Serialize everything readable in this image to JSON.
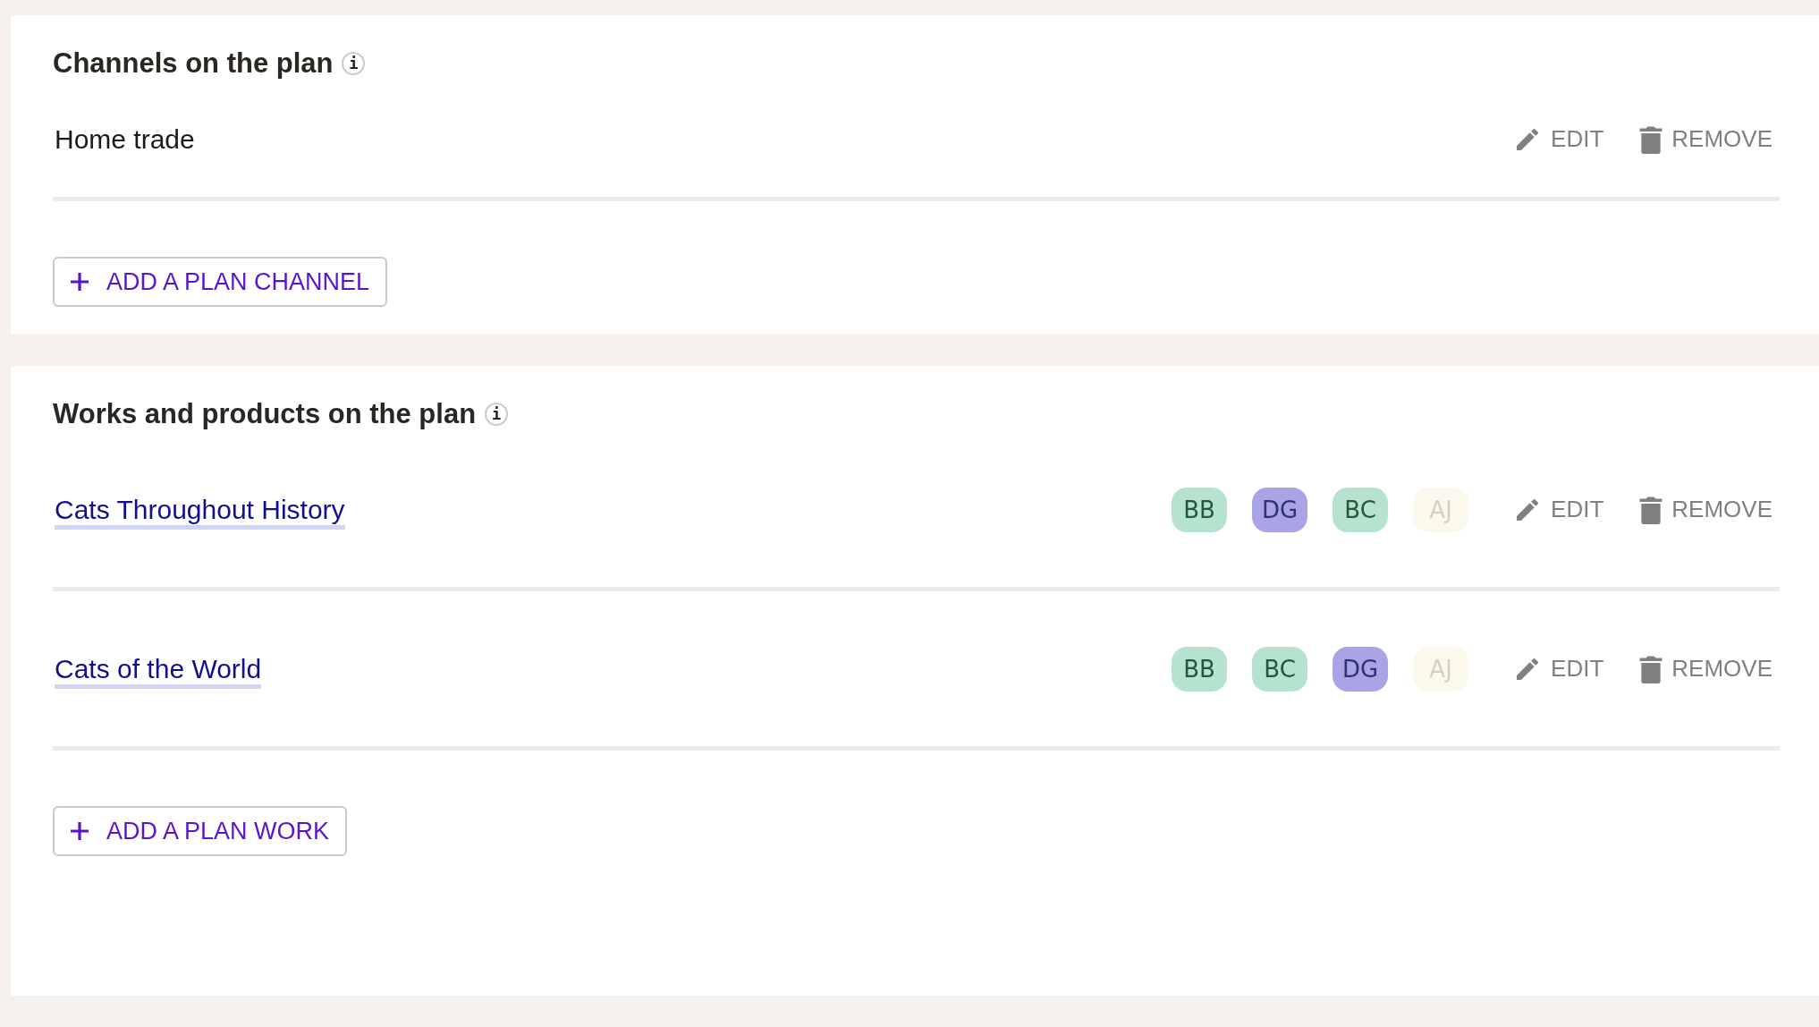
{
  "sections": [
    {
      "title": "Channels on the plan",
      "info_icon": "i",
      "items": [
        {
          "label": "Home trade",
          "kind": "plain",
          "actions": [
            "EDIT",
            "REMOVE"
          ]
        }
      ],
      "add_button": "ADD A PLAN CHANNEL"
    },
    {
      "title": "Works and products on the plan",
      "info_icon": "i",
      "items": [
        {
          "label": "Cats Throughout History",
          "kind": "link",
          "badges": [
            {
              "text": "BB",
              "color": "#b5e3cf",
              "dimmed": false
            },
            {
              "text": "DG",
              "color": "#a8a4e6",
              "dimmed": false
            },
            {
              "text": "BC",
              "color": "#b5e3cf",
              "dimmed": false
            },
            {
              "text": "AJ",
              "color": "#fbf8ec",
              "dimmed": true
            }
          ],
          "actions": [
            "EDIT",
            "REMOVE"
          ]
        },
        {
          "label": "Cats of the World",
          "kind": "link",
          "badges": [
            {
              "text": "BB",
              "color": "#b5e3cf",
              "dimmed": false
            },
            {
              "text": "BC",
              "color": "#b5e3cf",
              "dimmed": false
            },
            {
              "text": "DG",
              "color": "#a8a4e6",
              "dimmed": false
            },
            {
              "text": "AJ",
              "color": "#fbf8ec",
              "dimmed": true
            }
          ],
          "actions": [
            "EDIT",
            "REMOVE"
          ]
        }
      ],
      "add_button": "ADD A PLAN WORK"
    }
  ]
}
